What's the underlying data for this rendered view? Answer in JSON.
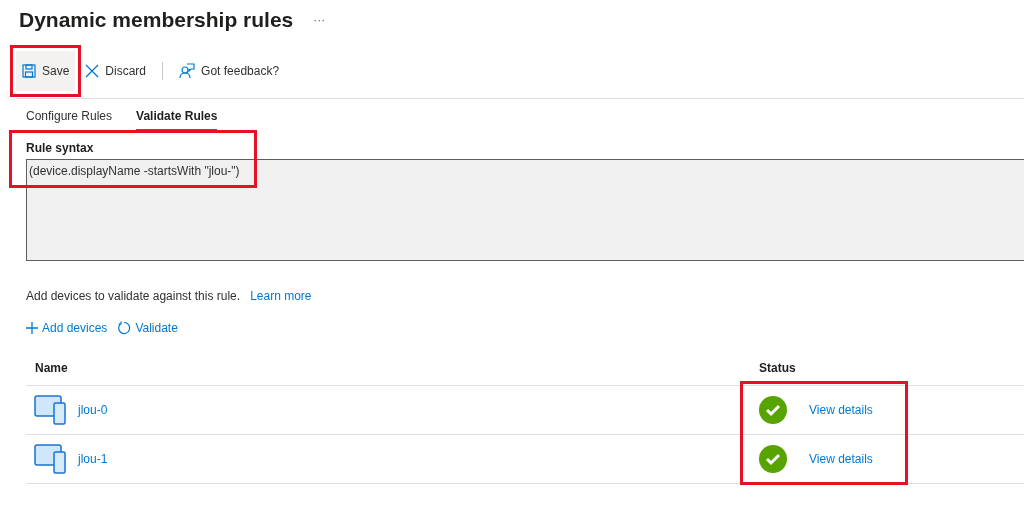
{
  "page": {
    "title": "Dynamic membership rules",
    "more": "···"
  },
  "toolbar": [
    {
      "kind": "save",
      "label": "Save",
      "highlighted": true
    },
    {
      "kind": "discard",
      "label": "Discard",
      "highlighted": false
    },
    {
      "kind": "feedback",
      "label": "Got feedback?",
      "highlighted": false
    }
  ],
  "tabs": [
    {
      "label": "Configure Rules",
      "selected": false
    },
    {
      "label": "Validate Rules",
      "selected": true
    }
  ],
  "rule_syntax": {
    "label": "Rule syntax",
    "value": "(device.displayName -startsWith \"jlou-\")",
    "highlighted": true
  },
  "validate": {
    "text": "Add devices to validate against this rule.",
    "link": "Learn more",
    "actions": [
      {
        "kind": "add",
        "label": "Add devices"
      },
      {
        "kind": "validate",
        "label": "Validate"
      }
    ]
  },
  "table": {
    "columns": [
      "Name",
      "Status"
    ],
    "status_highlighted": true,
    "rows": [
      {
        "name": "jlou-0",
        "passed": true,
        "details": "View details"
      },
      {
        "name": "jlou-1",
        "passed": true,
        "details": "View details"
      }
    ]
  }
}
